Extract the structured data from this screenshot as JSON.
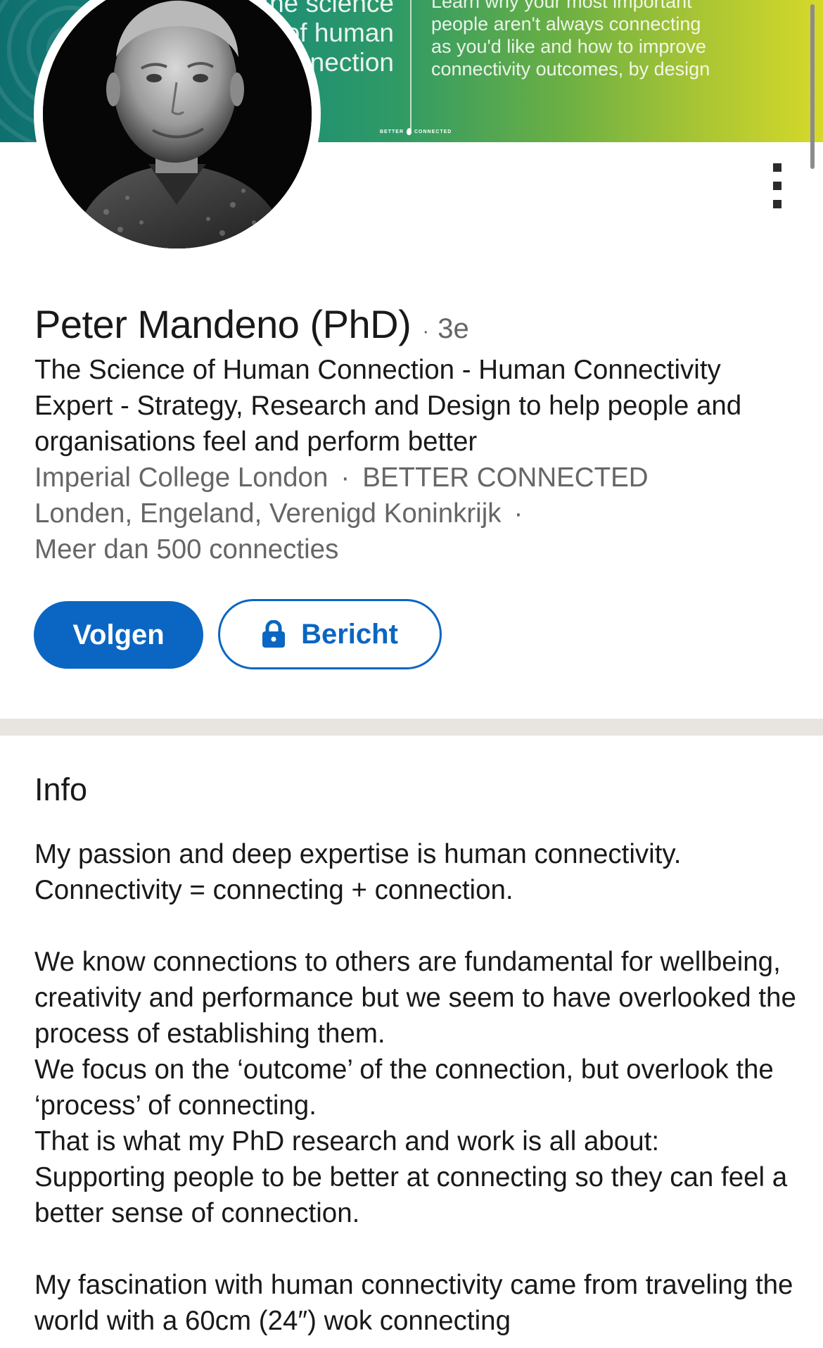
{
  "banner": {
    "big_lines": [
      "the science",
      "of human",
      "connection"
    ],
    "small_lines": [
      "Learn why your most important",
      "people aren't always connecting",
      "as you'd like and how to improve",
      "connectivity outcomes, by design"
    ],
    "brand_left": "BETTER",
    "brand_right": "CONNECTED"
  },
  "profile": {
    "name": "Peter Mandeno (PhD)",
    "separator": "·",
    "degree": "3e",
    "headline": "The Science of Human Connection - Human Connectivity Expert - Strategy, Research and Design to help people and organisations feel and perform better",
    "education": "Imperial College London",
    "company": "BETTER CONNECTED",
    "location": "Londen, Engeland, Verenigd Koninkrijk",
    "connections": "Meer dan 500 connecties"
  },
  "actions": {
    "follow_label": "Volgen",
    "message_label": "Bericht"
  },
  "info": {
    "title": "Info",
    "paragraphs": [
      "My passion and deep expertise is human connectivity.\nConnectivity = connecting + connection.",
      "We know connections to others are fundamental for wellbeing, creativity and performance but we seem to have overlooked the process of establishing them.\nWe focus on the ‘outcome’ of the connection, but overlook the ‘process’ of connecting.\nThat is what my PhD research and work is all about:\nSupporting people to be better at connecting so they can feel a better sense of connection.",
      "My fascination with human connectivity came from traveling the world with a 60cm (24″) wok connecting"
    ]
  },
  "colors": {
    "accent": "#0a66c2",
    "text_primary": "#191919",
    "text_secondary": "#666666",
    "separator": "#e8e5e0"
  },
  "icons": {
    "more": "more-vertical-icon",
    "lock": "lock-icon"
  }
}
